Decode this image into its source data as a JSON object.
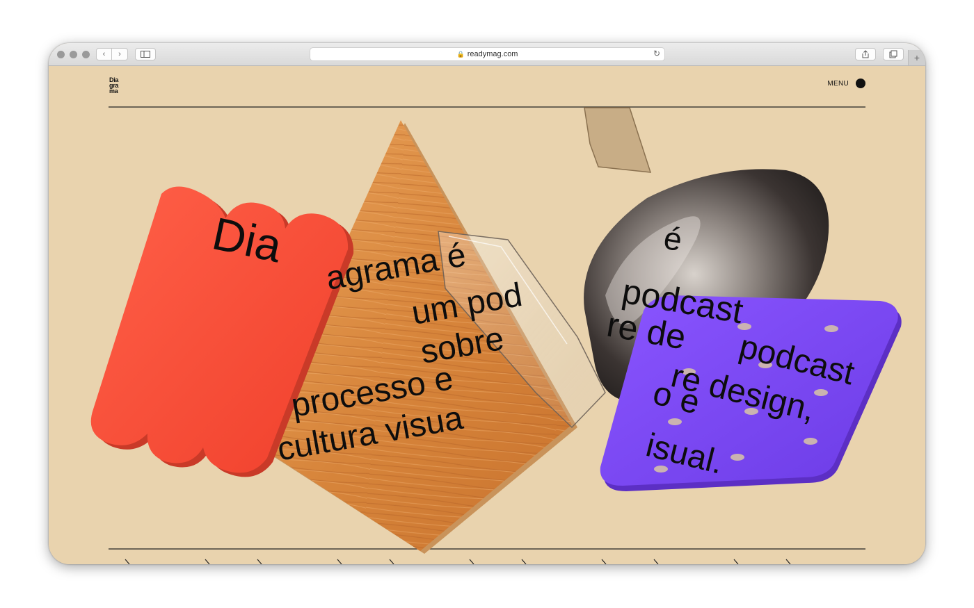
{
  "browser": {
    "url": "readymag.com",
    "colors": {
      "chrome": "#dcdcdc",
      "page_bg": "#e9d3ae"
    }
  },
  "site": {
    "logo_lines": [
      "Dia",
      "gra",
      "ma"
    ],
    "menu_label": "MENU"
  },
  "hero": {
    "layers": [
      {
        "word": "Diagrama",
        "shape": "red-pill-block"
      },
      {
        "word": "é",
        "shape": "silver-pod"
      }
    ],
    "text_red": "Dia",
    "text_wood": [
      "agrama é",
      "um pod",
      "sobre",
      "processo e",
      "cultura visua"
    ],
    "text_chrome": [
      "é",
      "podcast",
      "re de"
    ],
    "text_purple": [
      "podcast",
      "re design,",
      "o e",
      "isual."
    ],
    "colors": {
      "red": "#ff4d3a",
      "wood": "#d98a3e",
      "purple": "#7b47f0",
      "chrome": "#3a3432"
    }
  }
}
